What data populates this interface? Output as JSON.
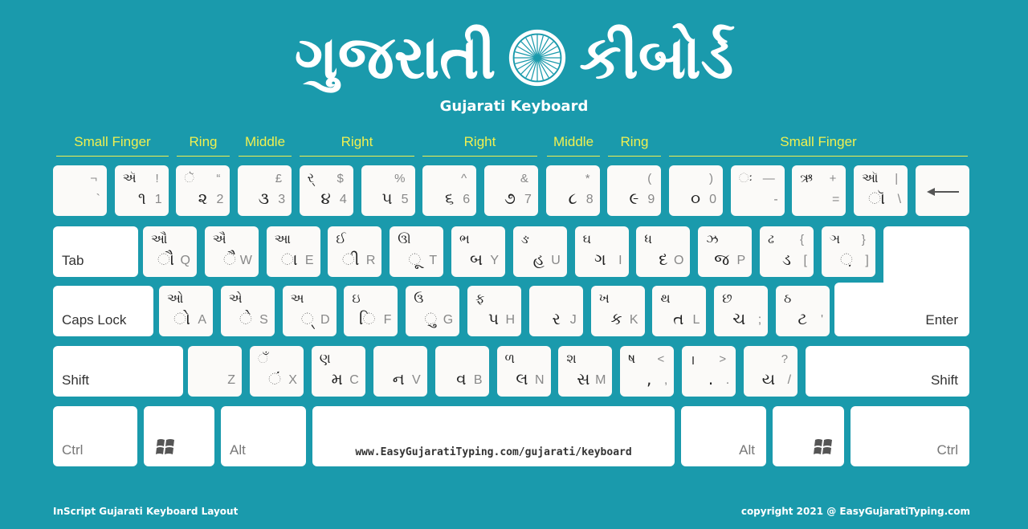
{
  "header": {
    "title_left": "ગુજરાતી",
    "title_right": "કીબોર્ડ",
    "subtitle": "Gujarati Keyboard",
    "emblem": "ashoka-chakra-icon"
  },
  "fingers": [
    "Small Finger",
    "Ring",
    "Middle",
    "Right",
    "Right",
    "Middle",
    "Ring",
    "Small Finger"
  ],
  "colors": {
    "background": "#1a9aac",
    "finger_label": "#f0f050",
    "key": "#fbfaf8"
  },
  "rows": {
    "number": [
      {
        "tl": "",
        "tr": "¬",
        "bm": "",
        "br": "`"
      },
      {
        "tl": "ઍ",
        "tr": "!",
        "bm": "૧",
        "br": "1"
      },
      {
        "tl": "ૅ",
        "tr": "“",
        "bm": "૨",
        "br": "2"
      },
      {
        "tl": "",
        "tr": "£",
        "bm": "૩",
        "br": "3"
      },
      {
        "tl": "ર્",
        "tr": "$",
        "bm": "૪",
        "br": "4"
      },
      {
        "tl": "",
        "tr": "%",
        "bm": "૫",
        "br": "5"
      },
      {
        "tl": "",
        "tr": "^",
        "bm": "૬",
        "br": "6"
      },
      {
        "tl": "",
        "tr": "&",
        "bm": "૭",
        "br": "7"
      },
      {
        "tl": "",
        "tr": "*",
        "bm": "૮",
        "br": "8"
      },
      {
        "tl": "",
        "tr": "(",
        "bm": "૯",
        "br": "9"
      },
      {
        "tl": "",
        "tr": ")",
        "bm": "૦",
        "br": "0"
      },
      {
        "tl": "ઃ",
        "tr": "—",
        "bm": "",
        "br": "-"
      },
      {
        "tl": "ઋ",
        "tr": "+",
        "bm": "",
        "br": "="
      },
      {
        "tl": "ઑ",
        "tr": "|",
        "bm": "ૉ",
        "br": "\\"
      }
    ],
    "backspace_icon": "backspace-arrow-icon",
    "top": [
      {
        "tl": "ઔ",
        "tr": "",
        "bm": "ૌ",
        "br": "Q"
      },
      {
        "tl": "ઐ",
        "tr": "",
        "bm": "ૈ",
        "br": "W"
      },
      {
        "tl": "આ",
        "tr": "",
        "bm": "ા",
        "br": "E"
      },
      {
        "tl": "ઈ",
        "tr": "",
        "bm": "ી",
        "br": "R"
      },
      {
        "tl": "ઊ",
        "tr": "",
        "bm": "ૂ",
        "br": "T"
      },
      {
        "tl": "ભ",
        "tr": "",
        "bm": "બ",
        "br": "Y"
      },
      {
        "tl": "ઙ",
        "tr": "",
        "bm": "હ",
        "br": "U"
      },
      {
        "tl": "ઘ",
        "tr": "",
        "bm": "ગ",
        "br": "I"
      },
      {
        "tl": "ધ",
        "tr": "",
        "bm": "દ",
        "br": "O"
      },
      {
        "tl": "ઝ",
        "tr": "",
        "bm": "જ",
        "br": "P"
      },
      {
        "tl": "ઢ",
        "tr": "{",
        "bm": "ડ",
        "br": "["
      },
      {
        "tl": "ઞ",
        "tr": "}",
        "bm": "઼",
        "br": "]"
      }
    ],
    "home": [
      {
        "tl": "ઓ",
        "tr": "",
        "bm": "ો",
        "br": "A"
      },
      {
        "tl": "એ",
        "tr": "",
        "bm": "ે",
        "br": "S"
      },
      {
        "tl": "અ",
        "tr": "",
        "bm": "્",
        "br": "D"
      },
      {
        "tl": "ઇ",
        "tr": "",
        "bm": "િ",
        "br": "F"
      },
      {
        "tl": "ઉ",
        "tr": "",
        "bm": "ુ",
        "br": "G"
      },
      {
        "tl": "ફ",
        "tr": "",
        "bm": "પ",
        "br": "H"
      },
      {
        "tl": "",
        "tr": "",
        "bm": "ર",
        "br": "J"
      },
      {
        "tl": "ખ",
        "tr": "",
        "bm": "ક",
        "br": "K"
      },
      {
        "tl": "થ",
        "tr": "",
        "bm": "ત",
        "br": "L"
      },
      {
        "tl": "છ",
        "tr": "",
        "bm": "ચ",
        "br": ";"
      },
      {
        "tl": "ઠ",
        "tr": "",
        "bm": "ટ",
        "br": "'"
      }
    ],
    "bottom": [
      {
        "tl": "",
        "tr": "",
        "bm": "",
        "br": "Z"
      },
      {
        "tl": "ઁ",
        "tr": "",
        "bm": "ં",
        "br": "X"
      },
      {
        "tl": "ણ",
        "tr": "",
        "bm": "મ",
        "br": "C"
      },
      {
        "tl": "",
        "tr": "",
        "bm": "ન",
        "br": "V"
      },
      {
        "tl": "",
        "tr": "",
        "bm": "વ",
        "br": "B"
      },
      {
        "tl": "ળ",
        "tr": "",
        "bm": "લ",
        "br": "N"
      },
      {
        "tl": "શ",
        "tr": "",
        "bm": "સ",
        "br": "M"
      },
      {
        "tl": "ષ",
        "tr": "<",
        "bm": ",",
        "br": ","
      },
      {
        "tl": "।",
        "tr": ">",
        "bm": ".",
        "br": "."
      },
      {
        "tl": "",
        "tr": "?",
        "bm": "ય",
        "br": "/"
      }
    ]
  },
  "modifiers": {
    "tab": "Tab",
    "caps": "Caps Lock",
    "enter": "Enter",
    "shift_left": "Shift",
    "shift_right": "Shift",
    "ctrl_left": "Ctrl",
    "ctrl_right": "Ctrl",
    "alt_left": "Alt",
    "alt_right": "Alt",
    "windows_icon": "windows-logo-icon"
  },
  "spacebar": {
    "url": "www.EasyGujaratiTyping.com/gujarati/keyboard"
  },
  "footer": {
    "left": "InScript Gujarati Keyboard Layout",
    "right": "copyright 2021 @ EasyGujaratiTyping.com"
  }
}
